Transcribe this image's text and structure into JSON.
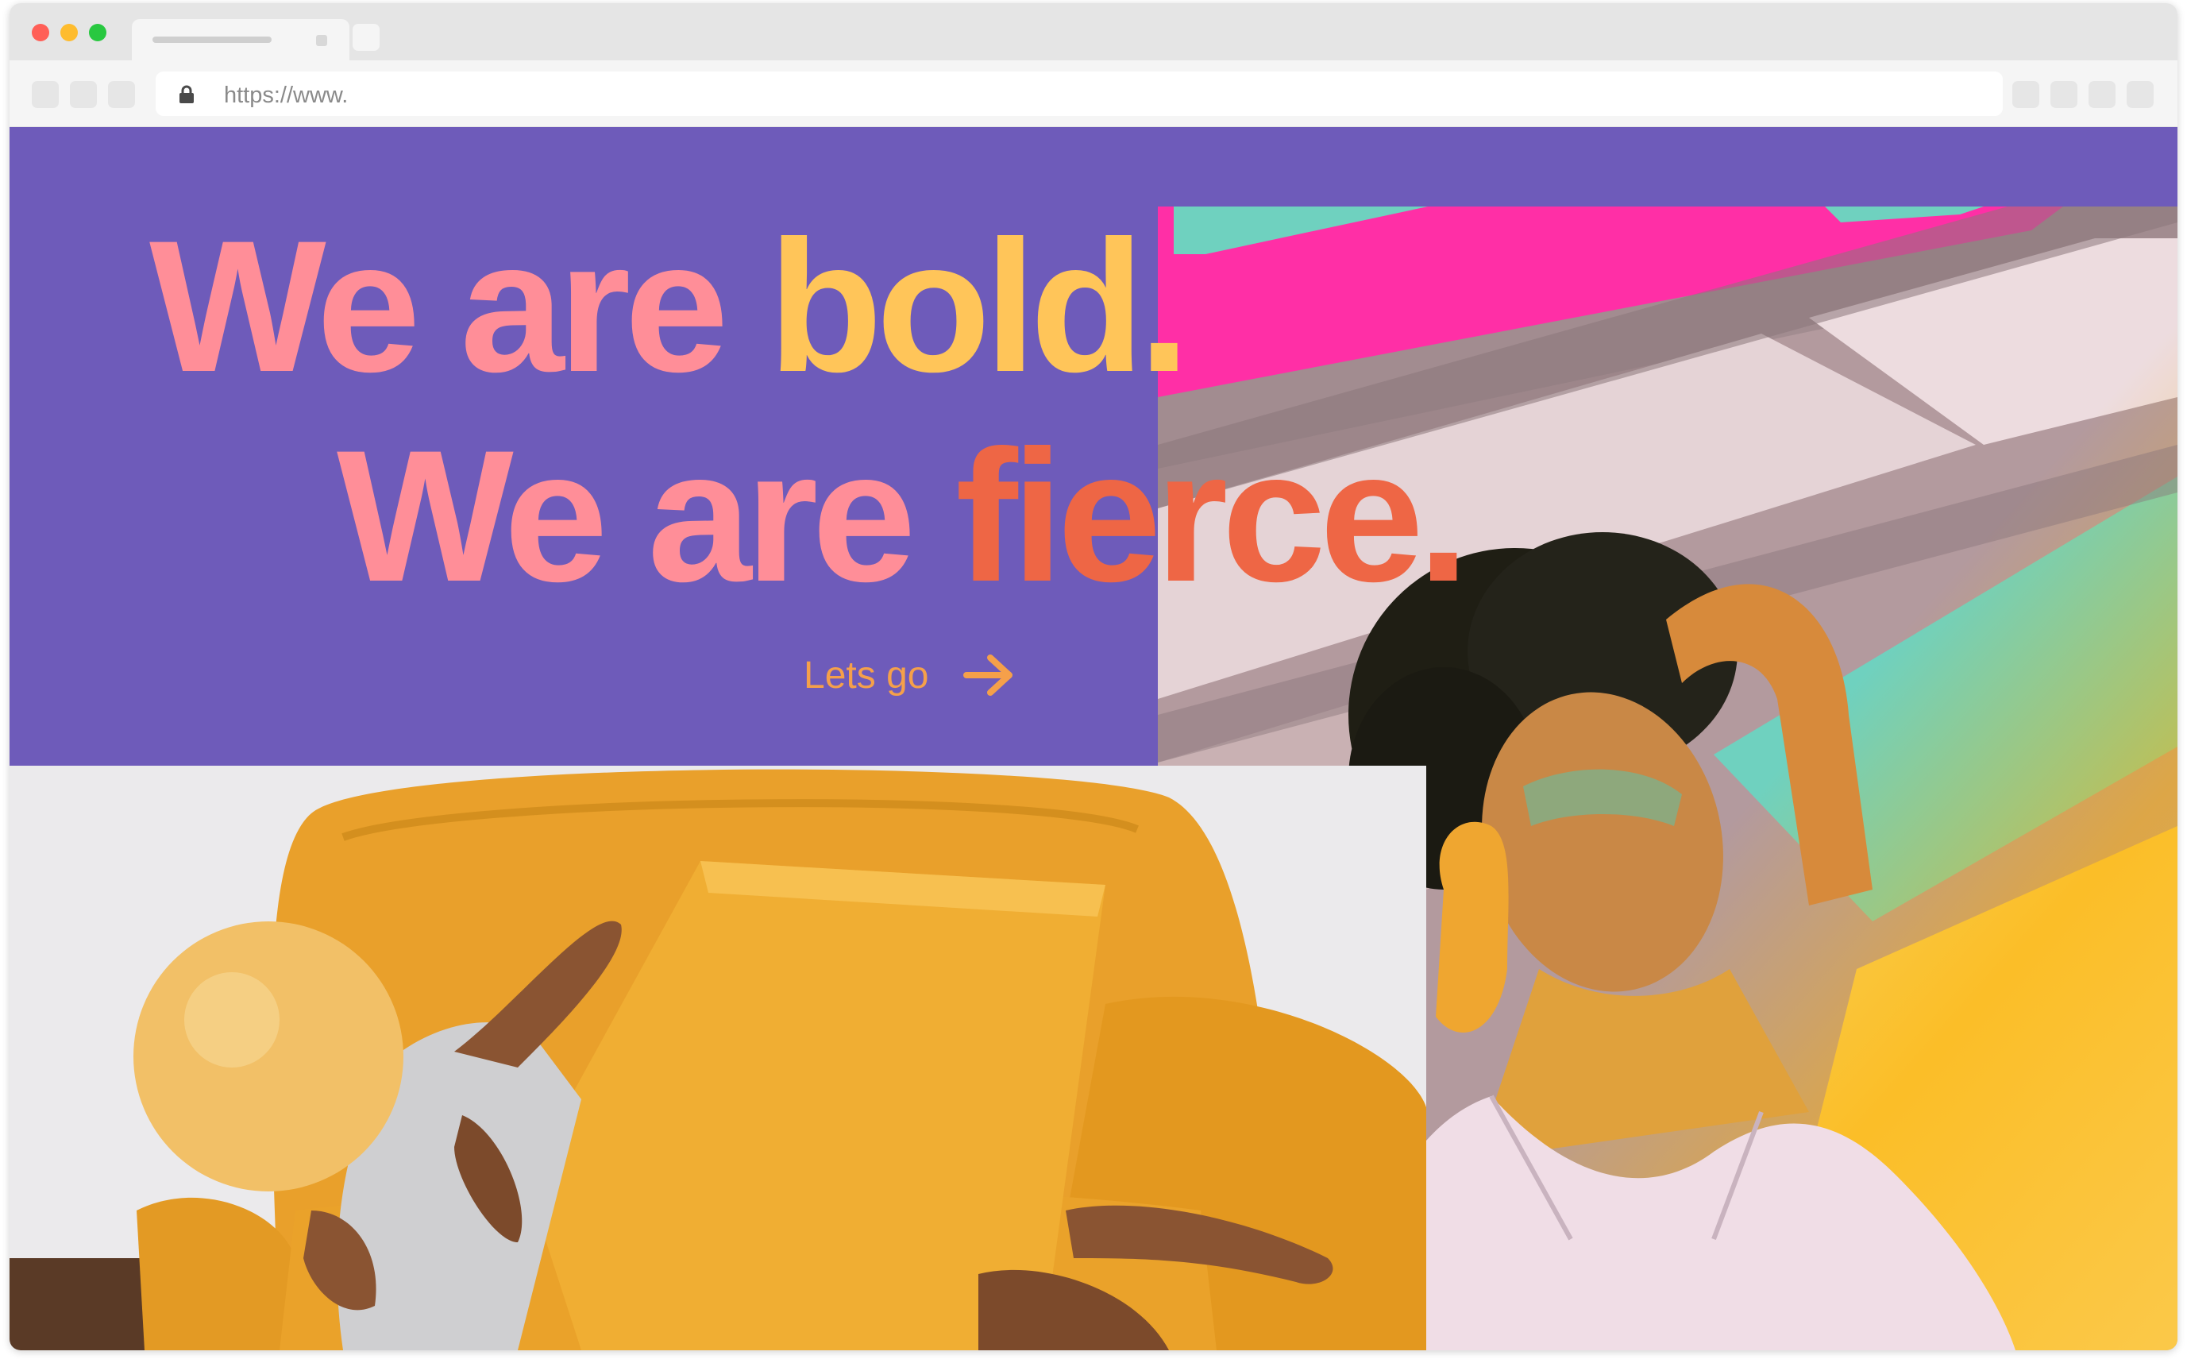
{
  "browser": {
    "url": "https://www."
  },
  "colors": {
    "hero_bg": "#6e5bba",
    "accent_pink": "#ff8e98",
    "accent_yellow": "#ffc559",
    "accent_orange": "#ee6645",
    "cta": "#f5a04a"
  },
  "hero": {
    "line1_part1": "We are ",
    "line1_part2": "bold.",
    "line2_part1": "We are ",
    "line2_part2": "fierce.",
    "cta_label": "Lets go",
    "cta_icon": "arrow-right-icon"
  }
}
